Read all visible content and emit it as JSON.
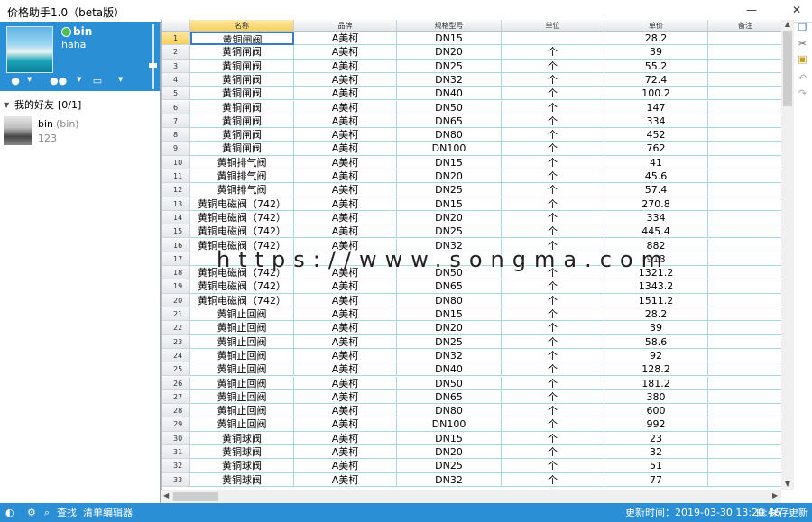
{
  "window": {
    "title": "价格助手1.0（beta版）",
    "minimize": "—",
    "close": "✕"
  },
  "profile": {
    "name": "bin",
    "signature": "haha"
  },
  "group": {
    "name": "我的好友",
    "count": "[0/1]"
  },
  "friend": {
    "name": "bin",
    "nick": "(bin)",
    "sign": "123"
  },
  "grid": {
    "columns": [
      "名称",
      "品牌",
      "规格型号",
      "单位",
      "单价",
      "备注"
    ],
    "rows": [
      {
        "n": "1",
        "name": "黄铜闸阀",
        "brand": "A美柯",
        "spec": "DN15",
        "unit": "",
        "price": "28.2"
      },
      {
        "n": "2",
        "name": "黄铜闸阀",
        "brand": "A美柯",
        "spec": "DN20",
        "unit": "个",
        "price": "39"
      },
      {
        "n": "3",
        "name": "黄铜闸阀",
        "brand": "A美柯",
        "spec": "DN25",
        "unit": "个",
        "price": "55.2"
      },
      {
        "n": "4",
        "name": "黄铜闸阀",
        "brand": "A美柯",
        "spec": "DN32",
        "unit": "个",
        "price": "72.4"
      },
      {
        "n": "5",
        "name": "黄铜闸阀",
        "brand": "A美柯",
        "spec": "DN40",
        "unit": "个",
        "price": "100.2"
      },
      {
        "n": "6",
        "name": "黄铜闸阀",
        "brand": "A美柯",
        "spec": "DN50",
        "unit": "个",
        "price": "147"
      },
      {
        "n": "7",
        "name": "黄铜闸阀",
        "brand": "A美柯",
        "spec": "DN65",
        "unit": "个",
        "price": "334"
      },
      {
        "n": "8",
        "name": "黄铜闸阀",
        "brand": "A美柯",
        "spec": "DN80",
        "unit": "个",
        "price": "452"
      },
      {
        "n": "9",
        "name": "黄铜闸阀",
        "brand": "A美柯",
        "spec": "DN100",
        "unit": "个",
        "price": "762"
      },
      {
        "n": "10",
        "name": "黄铜排气阀",
        "brand": "A美柯",
        "spec": "DN15",
        "unit": "个",
        "price": "41"
      },
      {
        "n": "11",
        "name": "黄铜排气阀",
        "brand": "A美柯",
        "spec": "DN20",
        "unit": "个",
        "price": "45.6"
      },
      {
        "n": "12",
        "name": "黄铜排气阀",
        "brand": "A美柯",
        "spec": "DN25",
        "unit": "个",
        "price": "57.4"
      },
      {
        "n": "13",
        "name": "黄铜电磁阀（742）",
        "brand": "A美柯",
        "spec": "DN15",
        "unit": "个",
        "price": "270.8"
      },
      {
        "n": "14",
        "name": "黄铜电磁阀（742）",
        "brand": "A美柯",
        "spec": "DN20",
        "unit": "个",
        "price": "334"
      },
      {
        "n": "15",
        "name": "黄铜电磁阀（742）",
        "brand": "A美柯",
        "spec": "DN25",
        "unit": "个",
        "price": "445.4"
      },
      {
        "n": "16",
        "name": "黄铜电磁阀（742）",
        "brand": "A美柯",
        "spec": "DN32",
        "unit": "个",
        "price": "882"
      },
      {
        "n": "17",
        "name": "",
        "brand": "",
        "spec": "",
        "unit": "",
        "price": "918"
      },
      {
        "n": "18",
        "name": "黄铜电磁阀（742）",
        "brand": "A美柯",
        "spec": "DN50",
        "unit": "个",
        "price": "1321.2"
      },
      {
        "n": "19",
        "name": "黄铜电磁阀（742）",
        "brand": "A美柯",
        "spec": "DN65",
        "unit": "个",
        "price": "1343.2"
      },
      {
        "n": "20",
        "name": "黄铜电磁阀（742）",
        "brand": "A美柯",
        "spec": "DN80",
        "unit": "个",
        "price": "1511.2"
      },
      {
        "n": "21",
        "name": "黄铜止回阀",
        "brand": "A美柯",
        "spec": "DN15",
        "unit": "个",
        "price": "28.2"
      },
      {
        "n": "22",
        "name": "黄铜止回阀",
        "brand": "A美柯",
        "spec": "DN20",
        "unit": "个",
        "price": "39"
      },
      {
        "n": "23",
        "name": "黄铜止回阀",
        "brand": "A美柯",
        "spec": "DN25",
        "unit": "个",
        "price": "58.6"
      },
      {
        "n": "24",
        "name": "黄铜止回阀",
        "brand": "A美柯",
        "spec": "DN32",
        "unit": "个",
        "price": "92"
      },
      {
        "n": "25",
        "name": "黄铜止回阀",
        "brand": "A美柯",
        "spec": "DN40",
        "unit": "个",
        "price": "128.2"
      },
      {
        "n": "26",
        "name": "黄铜止回阀",
        "brand": "A美柯",
        "spec": "DN50",
        "unit": "个",
        "price": "181.2"
      },
      {
        "n": "27",
        "name": "黄铜止回阀",
        "brand": "A美柯",
        "spec": "DN65",
        "unit": "个",
        "price": "380"
      },
      {
        "n": "28",
        "name": "黄铜止回阀",
        "brand": "A美柯",
        "spec": "DN80",
        "unit": "个",
        "price": "600"
      },
      {
        "n": "29",
        "name": "黄铜止回阀",
        "brand": "A美柯",
        "spec": "DN100",
        "unit": "个",
        "price": "992"
      },
      {
        "n": "30",
        "name": "黄铜球阀",
        "brand": "A美柯",
        "spec": "DN15",
        "unit": "个",
        "price": "23"
      },
      {
        "n": "31",
        "name": "黄铜球阀",
        "brand": "A美柯",
        "spec": "DN20",
        "unit": "个",
        "price": "32"
      },
      {
        "n": "32",
        "name": "黄铜球阀",
        "brand": "A美柯",
        "spec": "DN25",
        "unit": "个",
        "price": "51"
      },
      {
        "n": "33",
        "name": "黄铜球阀",
        "brand": "A美柯",
        "spec": "DN32",
        "unit": "个",
        "price": "77"
      }
    ]
  },
  "watermark": "https://www.songma.com",
  "statusbar": {
    "search": "查找",
    "list_editor": "清单编辑器",
    "updated_label": "更新时间：2019-03-30 13:20:46",
    "save": "保存更新"
  },
  "colors": {
    "accent": "#2b8fd6",
    "grid_line": "#a9d6e3",
    "header_selected": "#f7cf5a"
  }
}
